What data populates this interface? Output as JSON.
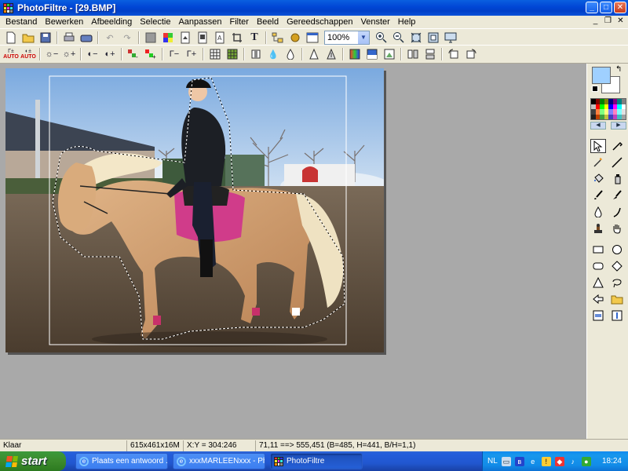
{
  "window": {
    "title": "PhotoFiltre - [29.BMP]",
    "buttons": [
      "_",
      "□",
      "✕"
    ],
    "doc_buttons": [
      "_",
      "❐",
      "✕"
    ]
  },
  "menu": [
    "Bestand",
    "Bewerken",
    "Afbeelding",
    "Selectie",
    "Aanpassen",
    "Filter",
    "Beeld",
    "Gereedschappen",
    "Venster",
    "Help"
  ],
  "toolbar": {
    "zoom": "100%",
    "auto_label": "AUTO"
  },
  "statusbar": {
    "state": "Klaar",
    "image_info": "615x461x16M",
    "cursor": "X:Y = 304:246",
    "selection": "71,11 ==> 555,451 (B=485, H=441, B/H=1,1)"
  },
  "taskbar": {
    "start_label": "start",
    "items": [
      {
        "label": "Plaats een antwoord ...",
        "icon": "ie-icon"
      },
      {
        "label": "xxxMARLEENxxx - Ph...",
        "icon": "ie-icon"
      },
      {
        "label": "PhotoFiltre",
        "icon": "photofiltre-icon"
      }
    ],
    "tray": {
      "lang": "NL",
      "time": "18:24"
    }
  },
  "colors": {
    "foreground": "#9fd0ff",
    "background": "#ffffff",
    "workspace": "#a9a9a9",
    "titlebar": "#0046d5",
    "start_button": "#3c8a2c"
  }
}
